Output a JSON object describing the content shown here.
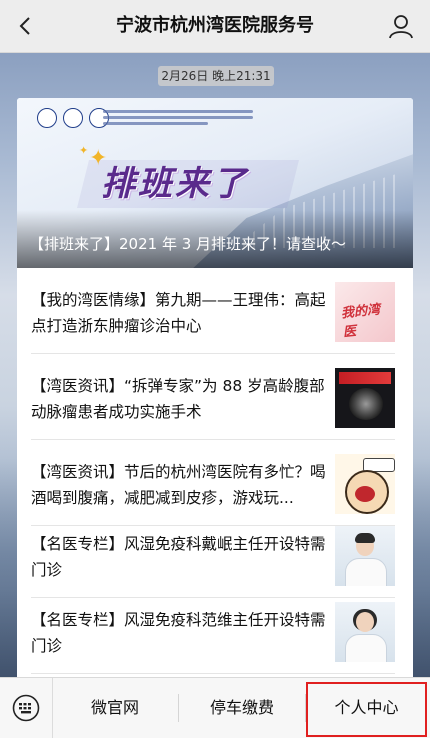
{
  "header": {
    "title": "宁波市杭州湾医院服务号",
    "back_icon": "chevron-left-icon",
    "user_icon": "user-icon"
  },
  "timestamp": "2月26日 晚上21:31",
  "banner": {
    "headline": "排班来了",
    "caption": "【排班来了】2021 年 3 月排班来了！请查收～"
  },
  "articles": [
    {
      "title": "【我的湾医情缘】第九期——王理伟：高起点打造浙东肿瘤诊治中心",
      "thumb_text": "我的湾医"
    },
    {
      "title": "【湾医资讯】“拆弹专家”为 88 岁高龄腹部动脉瘤患者成功实施手术"
    },
    {
      "title": "【湾医资讯】节后的杭州湾医院有多忙？喝酒喝到腹痛，减肥减到皮疹，游戏玩..."
    },
    {
      "title": "【名医专栏】风湿免疫科戴岷主任开设特需门诊"
    },
    {
      "title": "【名医专栏】风湿免疫科范维主任开设特需门诊"
    }
  ],
  "bottom_menu": {
    "keyboard_icon": "keyboard-icon",
    "items": [
      "微官网",
      "停车缴费",
      "个人中心"
    ],
    "highlight_color": "#e02020"
  }
}
